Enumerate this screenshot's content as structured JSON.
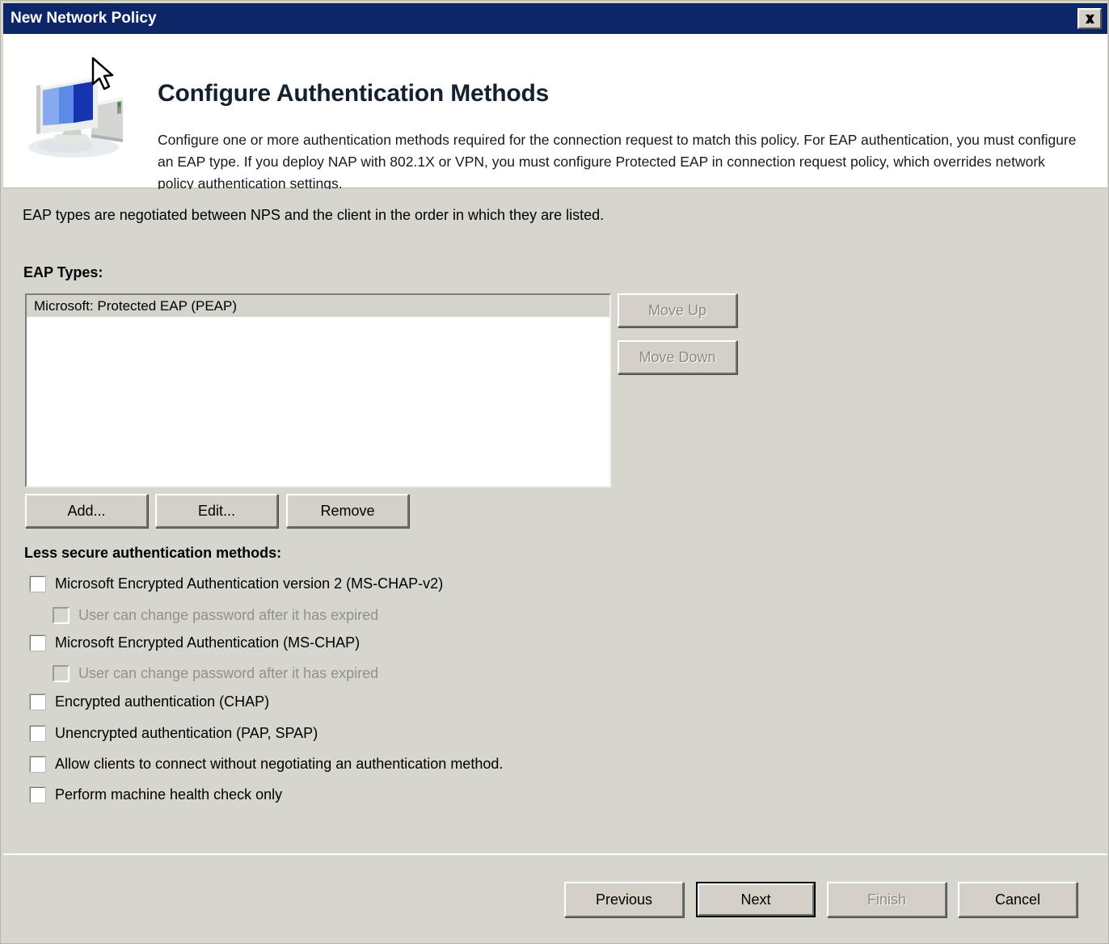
{
  "window": {
    "title": "New Network Policy",
    "close_icon": "close-icon",
    "accent_titlebar_color": "#0d2668",
    "dialog_background_color": "#d6d6ce"
  },
  "header": {
    "icon": "computer-monitor-icon",
    "title": "Configure Authentication Methods",
    "description": "Configure one or more authentication methods required for the connection request to match this policy. For EAP authentication, you must configure an EAP type. If you deploy NAP with 802.1X or VPN, you must configure Protected EAP in connection request policy, which overrides network policy authentication settings."
  },
  "main": {
    "intro_text": "EAP types are negotiated between NPS and the client in the order in which they are listed.",
    "eap_types_label": "EAP Types:",
    "eap_types": [
      {
        "label": "Microsoft: Protected EAP (PEAP)",
        "selected": true
      }
    ],
    "order_buttons": [
      {
        "label": "Move Up",
        "enabled": false
      },
      {
        "label": "Move Down",
        "enabled": false
      }
    ],
    "list_buttons": [
      {
        "label": "Add...",
        "enabled": true
      },
      {
        "label": "Edit...",
        "enabled": true
      },
      {
        "label": "Remove",
        "enabled": true
      }
    ],
    "less_secure_label": "Less secure authentication methods:",
    "checkboxes": [
      {
        "label": "Microsoft Encrypted Authentication version 2 (MS-CHAP-v2)",
        "checked": false,
        "enabled": true,
        "indent": false
      },
      {
        "label": "User can change password after it has expired",
        "checked": false,
        "enabled": false,
        "indent": true
      },
      {
        "label": "Microsoft Encrypted Authentication (MS-CHAP)",
        "checked": false,
        "enabled": true,
        "indent": false
      },
      {
        "label": "User can change password after it has expired",
        "checked": false,
        "enabled": false,
        "indent": true
      },
      {
        "label": "Encrypted authentication (CHAP)",
        "checked": false,
        "enabled": true,
        "indent": false
      },
      {
        "label": "Unencrypted authentication (PAP, SPAP)",
        "checked": false,
        "enabled": true,
        "indent": false
      },
      {
        "label": "Allow clients to connect without negotiating an authentication method.",
        "checked": false,
        "enabled": true,
        "indent": false
      },
      {
        "label": "Perform machine health check only",
        "checked": false,
        "enabled": true,
        "indent": false
      }
    ]
  },
  "footer": {
    "buttons": [
      {
        "label": "Previous",
        "enabled": true,
        "default": false
      },
      {
        "label": "Next",
        "enabled": true,
        "default": true
      },
      {
        "label": "Finish",
        "enabled": false,
        "default": false
      },
      {
        "label": "Cancel",
        "enabled": true,
        "default": false
      }
    ]
  }
}
